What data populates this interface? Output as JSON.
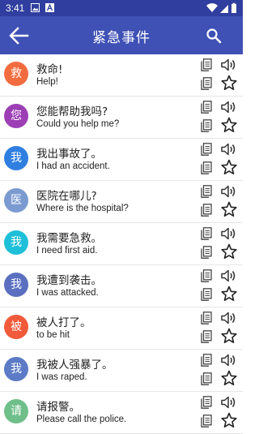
{
  "status_bar": {
    "time": "3:41"
  },
  "app_bar": {
    "title": "紧急事件"
  },
  "colors": {
    "status_bar": "#303f9f",
    "app_bar": "#3f51b5"
  },
  "phrases": [
    {
      "avatar": "救",
      "avatar_color": "#f26c3f",
      "chinese": "救命!",
      "english": "Help!"
    },
    {
      "avatar": "您",
      "avatar_color": "#9c3fb5",
      "chinese": "您能帮助我吗?",
      "english": "Could you help me?"
    },
    {
      "avatar": "我",
      "avatar_color": "#2f7fe0",
      "chinese": "我出事故了。",
      "english": "I had an accident."
    },
    {
      "avatar": "医",
      "avatar_color": "#7a9ad0",
      "chinese": "医院在哪儿?",
      "english": "Where is the hospital?"
    },
    {
      "avatar": "我",
      "avatar_color": "#1ebfd8",
      "chinese": "我需要急救。",
      "english": "I need first aid."
    },
    {
      "avatar": "我",
      "avatar_color": "#5b6fc0",
      "chinese": "我遭到袭击。",
      "english": "I was attacked."
    },
    {
      "avatar": "被",
      "avatar_color": "#f15a3a",
      "chinese": "被人打了。",
      "english": "to be hit"
    },
    {
      "avatar": "我",
      "avatar_color": "#5c7ac5",
      "chinese": "我被人强暴了。",
      "english": "I was raped."
    },
    {
      "avatar": "请",
      "avatar_color": "#6fbf8a",
      "chinese": "请报警。",
      "english": "Please call the police."
    }
  ]
}
